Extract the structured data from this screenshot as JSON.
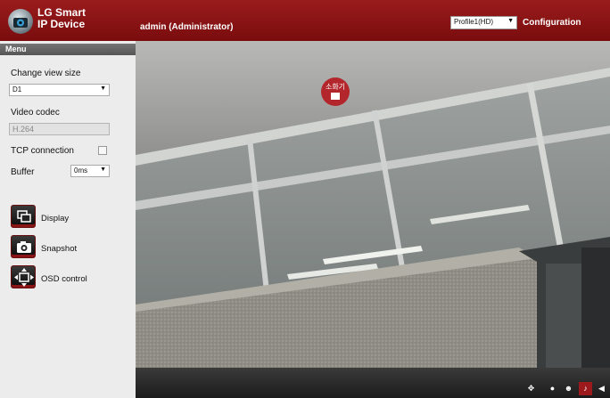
{
  "header": {
    "brand_line1": "LG Smart",
    "brand_line2": "IP Device",
    "user": "admin (Administrator)",
    "profile_value": "Profile1(HD)",
    "config_link": "Configuration",
    "accent_color": "#8c1416"
  },
  "sidebar": {
    "menu_title": "Menu",
    "change_view_label": "Change view size",
    "view_size_value": "D1",
    "video_codec_label": "Video codec",
    "video_codec_value": "H.264",
    "tcp_label": "TCP connection",
    "tcp_checked": false,
    "buffer_label": "Buffer",
    "buffer_value": "0ms",
    "tools": [
      {
        "label": "Display",
        "icon": "display-icon"
      },
      {
        "label": "Snapshot",
        "icon": "camera-icon"
      },
      {
        "label": "OSD control",
        "icon": "osd-move-icon"
      }
    ]
  },
  "video": {
    "sign_text": "소화기"
  },
  "controls": [
    {
      "icon": "ptz-icon"
    },
    {
      "icon": "record-icon"
    },
    {
      "icon": "talk-icon"
    },
    {
      "icon": "microphone-icon"
    },
    {
      "icon": "speaker-icon"
    }
  ]
}
